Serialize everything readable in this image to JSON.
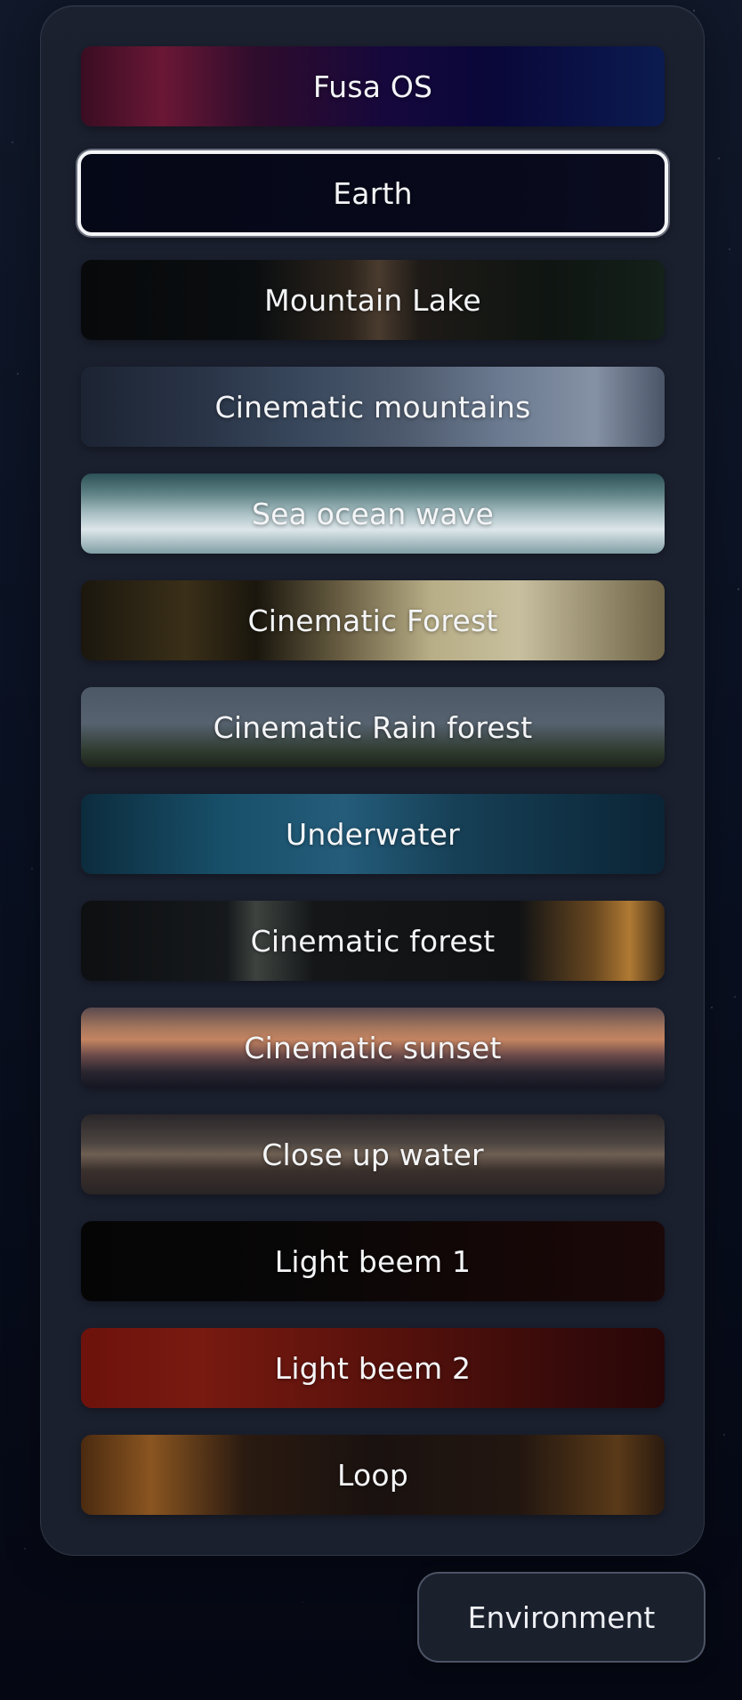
{
  "environments": {
    "items": [
      {
        "label": "Fusa OS",
        "selected": false,
        "background": "linear-gradient(90deg, #3a0d22 0%, #6a1735 14%, #2f0c2c 30%, #16083c 52%, #0a0739 70%, #0b1b50 100%)"
      },
      {
        "label": "Earth",
        "selected": true,
        "background": "linear-gradient(90deg, #050817 0%, #07091a 50%, #0a0c1f 100%)"
      },
      {
        "label": "Mountain Lake",
        "selected": false,
        "background": "linear-gradient(90deg, #07090b 0%, #0b0e10 30%, #2c241c 46%, #4a3b2e 51%, #1e1a17 58%, #0f1512 80%, #14201a 100%)"
      },
      {
        "label": "Cinematic mountains",
        "selected": false,
        "background": "linear-gradient(90deg, #1c2433 0%, #2a3548 22%, #3b4a5f 40%, #4d596c 55%, #6b7a90 72%, #8591a4 88%, #4a5568 100%)"
      },
      {
        "label": "Sea ocean wave",
        "selected": false,
        "background": "linear-gradient(180deg, #2c5156 0%, #5e8285 25%, #a9c0c4 50%, #dde6ea 70%, #7f9ea4 100%)"
      },
      {
        "label": "Cinematic Forest",
        "selected": false,
        "background": "linear-gradient(90deg, #1b170e 0%, #3a2f18 18%, #1a160d 30%, #6b6044 45%, #b7ad86 60%, #c7bf9e 75%, #6e6346 100%)"
      },
      {
        "label": "Cinematic Rain forest",
        "selected": false,
        "background": "linear-gradient(180deg, #4c5866 0%, #56626f 45%, #2f3b2f 80%, #1c231c 100%)"
      },
      {
        "label": "Underwater",
        "selected": false,
        "background": "linear-gradient(90deg, #0c2c3d 0%, #18506a 25%, #245c7a 45%, #163f55 65%, #0b2436 100%)"
      },
      {
        "label": "Cinematic forest",
        "selected": false,
        "background": "linear-gradient(90deg, #0d0f11 0%, #16191c 25%, #3d433f 30%, #141618 40%, #101214 75%, #6a4820 88%, #b07a33 94%, #3c2a16 100%)"
      },
      {
        "label": "Cinematic sunset",
        "selected": false,
        "background": "linear-gradient(180deg, #5a4a4e 0%, #a5765d 25%, #c48461 40%, #6b4a4a 60%, #2a2630 80%, #141622 100%)"
      },
      {
        "label": "Close up water",
        "selected": false,
        "background": "linear-gradient(180deg, #2a2628 0%, #4b4440 35%, #6e5f52 50%, #3a302c 70%, #2a2426 100%)"
      },
      {
        "label": "Light beem 1",
        "selected": false,
        "background": "linear-gradient(90deg, #050506 0%, #080707 35%, #140707 70%, #1b0808 100%)"
      },
      {
        "label": "Light beem 2",
        "selected": false,
        "background": "linear-gradient(90deg, #6d120c 0%, #781a10 20%, #5a120c 50%, #3a0b0a 80%, #280708 100%)"
      },
      {
        "label": "Loop",
        "selected": false,
        "background": "linear-gradient(90deg, #4a2a10 0%, #8a5520 12%, #2a1a10 28%, #1a1210 50%, #221610 75%, #5a3a18 92%, #2a1a10 100%)"
      }
    ]
  },
  "footer": {
    "environment_button_label": "Environment"
  },
  "colors": {
    "panel_background": "#1c2130",
    "text": "#f4f5f7",
    "selected_border": "#f3f4f6"
  }
}
